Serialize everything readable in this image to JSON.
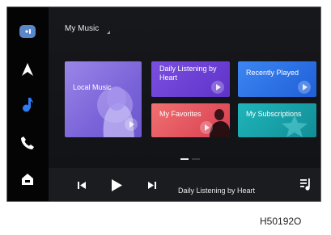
{
  "header": {
    "title": "My Music"
  },
  "sidebar": {
    "items": [
      {
        "icon": "voice-assistant-icon"
      },
      {
        "icon": "navigation-arrow-icon"
      },
      {
        "icon": "music-note-icon",
        "active": true
      },
      {
        "icon": "phone-icon"
      },
      {
        "icon": "home-icon"
      }
    ]
  },
  "tiles": [
    {
      "label": "Local Music"
    },
    {
      "label": "Daily Listening by Heart"
    },
    {
      "label": "Recently Played"
    },
    {
      "label": "My Favorites"
    },
    {
      "label": "My Subscriptions"
    }
  ],
  "player": {
    "now_playing": "Daily Listening by Heart",
    "controls": [
      "previous-icon",
      "play-icon",
      "next-icon",
      "playlist-icon"
    ]
  },
  "caption": "H50192O",
  "colors": {
    "background": "#0d0d10",
    "accent_blue": "#2e7cf6",
    "tile_local": "#8a73e0",
    "tile_daily": "#6c3fd6",
    "tile_recent": "#2a6fe6",
    "tile_favorites": "#e05560",
    "tile_subscriptions": "#17a6ad"
  }
}
